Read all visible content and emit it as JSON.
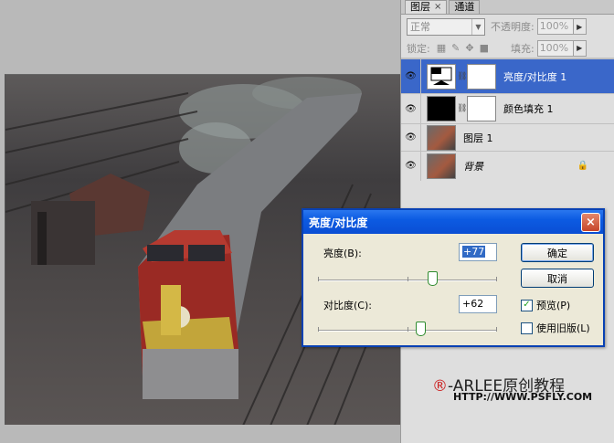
{
  "panel": {
    "tabs": [
      {
        "label": "图层",
        "close": "×"
      },
      {
        "label": "通道"
      }
    ],
    "blend_mode": "正常",
    "opacity_label": "不透明度:",
    "opacity_value": "100%",
    "lock_label": "锁定:",
    "fill_label": "填充:",
    "fill_value": "100%",
    "layers": [
      {
        "name": "亮度/对比度 1",
        "thumb": "adjustment",
        "selected": true,
        "has_mask": true
      },
      {
        "name": "颜色填充 1",
        "thumb": "black",
        "selected": false,
        "has_mask": true
      },
      {
        "name": "图层 1",
        "thumb": "photo",
        "selected": false,
        "has_mask": false
      },
      {
        "name": "背景",
        "thumb": "photo",
        "selected": false,
        "has_mask": false,
        "locked": true
      }
    ]
  },
  "dialog": {
    "title": "亮度/对比度",
    "close": "×",
    "brightness_label": "亮度(B):",
    "brightness_value": "+77",
    "brightness_level": 0.77,
    "contrast_label": "对比度(C):",
    "contrast_value": "+62",
    "contrast_level": 0.62,
    "ok": "确定",
    "cancel": "取消",
    "preview_label": "预览(P)",
    "preview_checked": true,
    "legacy_label": "使用旧版(L)",
    "legacy_checked": false,
    "check_mark": "✓"
  },
  "watermark": {
    "mark": "®",
    "text": "-ARLEE原创教程",
    "url": "HTTP://WWW.PSFLY.COM"
  },
  "colors": {
    "selected_layer": "#3a67c9",
    "titlebar": "#0a4ed4",
    "close_button": "#c6452a"
  }
}
